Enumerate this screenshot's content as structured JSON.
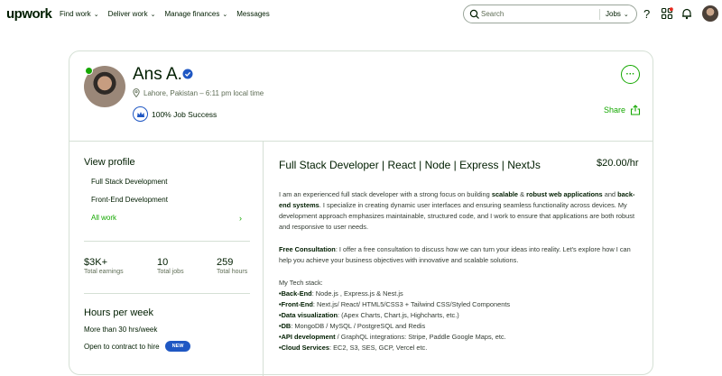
{
  "nav": {
    "logo": "upwork",
    "links": [
      "Find work",
      "Deliver work",
      "Manage finances",
      "Messages"
    ],
    "search_placeholder": "Search",
    "search_scope": "Jobs"
  },
  "profile": {
    "name": "Ans A.",
    "location": "Lahore, Pakistan – 6:11 pm local time",
    "job_success": "100% Job Success",
    "more_label": "···",
    "share_label": "Share"
  },
  "sidebar": {
    "view_profile": "View profile",
    "items": [
      "Full Stack Development",
      "Front-End Development",
      "All work"
    ],
    "chevron": "›",
    "stats": [
      {
        "value": "$3K+",
        "label": "Total earnings"
      },
      {
        "value": "10",
        "label": "Total jobs"
      },
      {
        "value": "259",
        "label": "Total hours"
      }
    ],
    "hours_title": "Hours per week",
    "hours_value": "More than 30 hrs/week",
    "contract_label": "Open to contract to hire",
    "new_badge": "NEW"
  },
  "main": {
    "title": "Full Stack Developer | React | Node | Express | NextJs",
    "rate": "$20.00/hr",
    "p1": {
      "a": "I am an experienced full stack developer with a strong focus on building ",
      "b1": "scalable",
      "c": " & ",
      "b2": "robust web applications",
      "d": " and ",
      "b3": "back-end systems",
      "e": ". I specialize in creating dynamic user interfaces and ensuring seamless functionality across devices. My development approach emphasizes maintainable, structured code, and I work to ensure that applications are both robust and responsive to user needs."
    },
    "p2": {
      "b": "Free Consultation",
      "t": ": I offer a free consultation to discuss how we can turn your ideas into reality. Let's explore how I can help you achieve your business objectives with innovative and scalable solutions."
    },
    "tech_title": "My Tech stack:",
    "tech": [
      {
        "k": "•Back-End",
        "v": ": Node.js , Express.js & Nest.js"
      },
      {
        "k": "•Front-End",
        "v": ": Next.js/ React/ HTML5/CSS3 + Tailwind CSS/Styled Components"
      },
      {
        "k": "•Data visualization",
        "v": ": (Apex Charts, Chart.js, Highcharts, etc.)"
      },
      {
        "k": "•DB",
        "v": ": MongoDB / MySQL / PostgreSQL and Redis"
      },
      {
        "k": "•API development",
        "v": " / GraphQL integrations: Stripe, Paddle Google Maps, etc."
      },
      {
        "k": "•Cloud Services",
        "v": ": EC2, S3, SES, GCP, Vercel etc."
      }
    ]
  },
  "colors": {
    "brand_green": "#14a800",
    "link_blue": "#1f57c3",
    "border": "#d5e0d5"
  }
}
